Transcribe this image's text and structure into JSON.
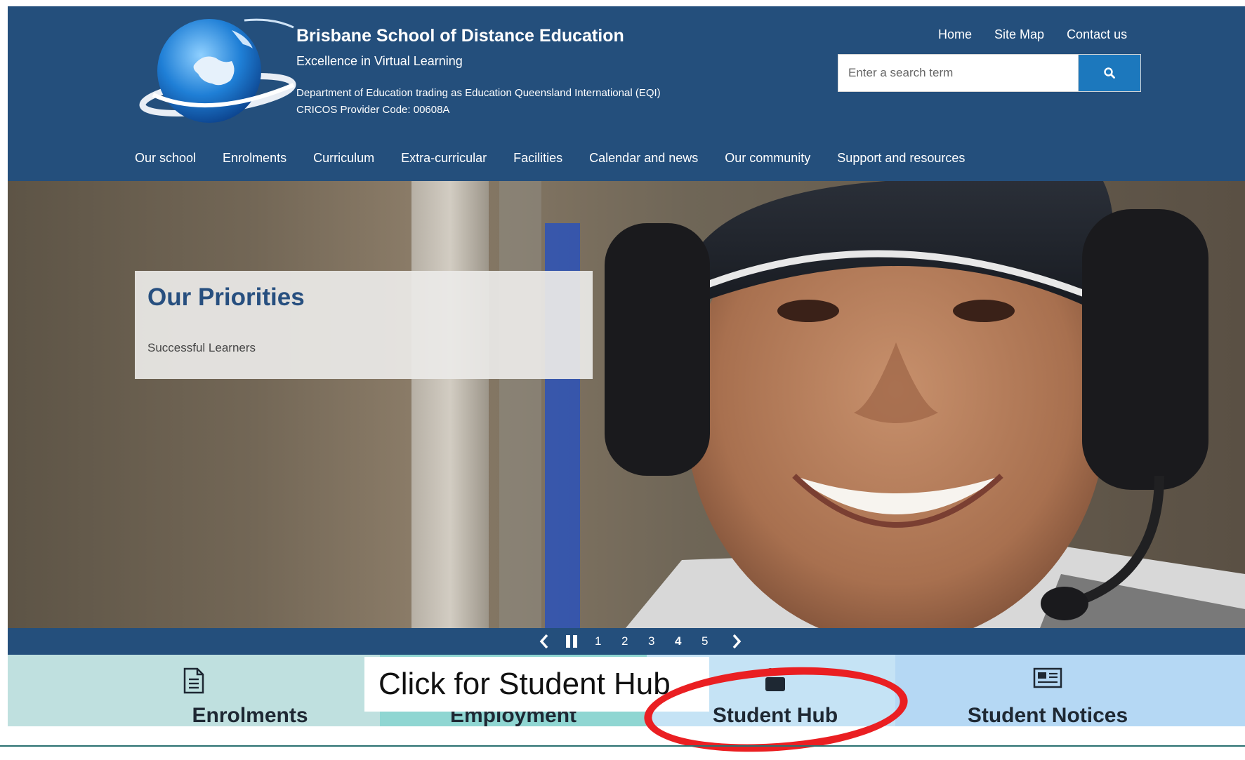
{
  "header": {
    "title": "Brisbane School of Distance Education",
    "tagline": "Excellence in Virtual Learning",
    "department": "Department of Education trading as Education Queensland International (EQI)",
    "cricos": "CRICOS Provider Code: 00608A",
    "utility_nav": [
      "Home",
      "Site Map",
      "Contact us"
    ],
    "search": {
      "placeholder": "Enter a search term"
    },
    "main_nav": [
      "Our school",
      "Enrolments",
      "Curriculum",
      "Extra-curricular",
      "Facilities",
      "Calendar and news",
      "Our community",
      "Support and resources"
    ]
  },
  "hero": {
    "heading": "Our Priorities",
    "item": "Successful Learners"
  },
  "carousel": {
    "pages": [
      "1",
      "2",
      "3",
      "4",
      "5"
    ],
    "active_page": "4"
  },
  "tiles": [
    {
      "label": "Enrolments",
      "icon": "document-icon",
      "bg": "#bfe0df"
    },
    {
      "label": "Employment",
      "icon": "briefcase-icon",
      "bg": "#8fd6d2"
    },
    {
      "label": "Student Hub",
      "icon": "student-icon",
      "bg": "#c5e3f5"
    },
    {
      "label": "Student Notices",
      "icon": "newspaper-icon",
      "bg": "#b5d8f4"
    }
  ],
  "callout": "Click for Student Hub",
  "colors": {
    "header_bg": "#244f7c",
    "search_button": "#1c78bd",
    "annotation_red": "#ea1f22"
  }
}
